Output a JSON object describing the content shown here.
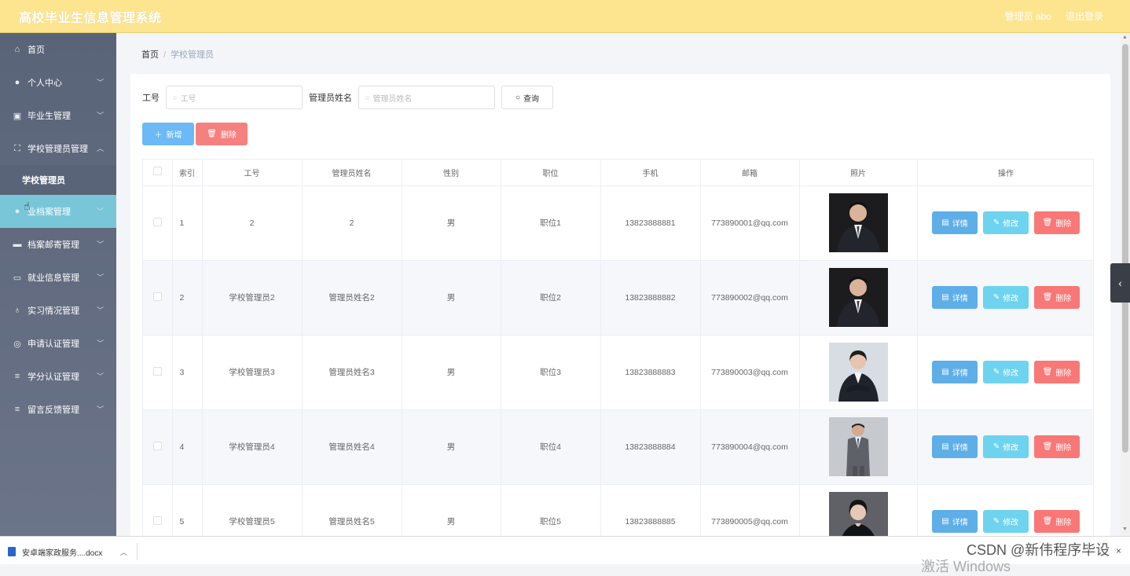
{
  "header": {
    "title": "高校毕业生信息管理系统",
    "user": "管理员 abo",
    "logout": "退出登录"
  },
  "sidebar": {
    "items": [
      {
        "label": "首页",
        "icon": "home-icon",
        "glyph": "⌂",
        "has_arrow": false
      },
      {
        "label": "个人中心",
        "icon": "user-icon",
        "glyph": "●",
        "has_arrow": true
      },
      {
        "label": "毕业生管理",
        "icon": "clipboard-icon",
        "glyph": "▣",
        "has_arrow": true
      },
      {
        "label": "学校管理员管理",
        "icon": "fullscreen-icon",
        "glyph": "⛶",
        "has_arrow": true,
        "expanded": true
      },
      {
        "label": "学校管理员",
        "submenu": true
      },
      {
        "label": "毕业档案管理",
        "icon": "user-icon",
        "glyph": "●",
        "has_arrow": true,
        "active": true,
        "visible_label": "业档案管理"
      },
      {
        "label": "档案邮寄管理",
        "icon": "briefcase-icon",
        "glyph": "▬",
        "has_arrow": true
      },
      {
        "label": "就业信息管理",
        "icon": "chat-icon",
        "glyph": "▭",
        "has_arrow": true
      },
      {
        "label": "实习情况管理",
        "icon": "microphone-icon",
        "glyph": "♁",
        "has_arrow": true
      },
      {
        "label": "申请认证管理",
        "icon": "compass-icon",
        "glyph": "◎",
        "has_arrow": true
      },
      {
        "label": "学分认证管理",
        "icon": "list-icon",
        "glyph": "≡",
        "has_arrow": true
      },
      {
        "label": "留言反馈管理",
        "icon": "list-icon",
        "glyph": "≡",
        "has_arrow": true
      }
    ]
  },
  "breadcrumb": {
    "home": "首页",
    "current": "学校管理员"
  },
  "search": {
    "id_label": "工号",
    "id_placeholder": "工号",
    "name_label": "管理员姓名",
    "name_placeholder": "管理员姓名",
    "query_button": "查询"
  },
  "actions": {
    "add": "新增",
    "delete": "删除"
  },
  "table": {
    "headers": [
      "",
      "索引",
      "工号",
      "管理员姓名",
      "性别",
      "职位",
      "手机",
      "邮箱",
      "照片",
      "操作"
    ],
    "rows": [
      {
        "index": "1",
        "id": "2",
        "name": "2",
        "gender": "男",
        "position": "职位1",
        "phone": "13823888881",
        "email": "773890001@qq.com",
        "photo": "man-suit"
      },
      {
        "index": "2",
        "id": "学校管理员2",
        "name": "管理员姓名2",
        "gender": "男",
        "position": "职位2",
        "phone": "13823888882",
        "email": "773890002@qq.com",
        "photo": "man-suit"
      },
      {
        "index": "3",
        "id": "学校管理员3",
        "name": "管理员姓名3",
        "gender": "男",
        "position": "职位3",
        "phone": "13823888883",
        "email": "773890003@qq.com",
        "photo": "woman-suit"
      },
      {
        "index": "4",
        "id": "学校管理员4",
        "name": "管理员姓名4",
        "gender": "男",
        "position": "职位4",
        "phone": "13823888884",
        "email": "773890004@qq.com",
        "photo": "man-grey"
      },
      {
        "index": "5",
        "id": "学校管理员5",
        "name": "管理员姓名5",
        "gender": "男",
        "position": "职位5",
        "phone": "13823888885",
        "email": "773890005@qq.com",
        "photo": "woman-dark"
      }
    ],
    "row_actions": {
      "detail": "详情",
      "edit": "修改",
      "delete": "删除"
    }
  },
  "download_bar": {
    "file": "安卓端家政服务....docx"
  },
  "watermark": "CSDN @新伟程序毕设",
  "os_overlay": "激活 Windows",
  "colors": {
    "header": "#fde58f",
    "sidebar": "#5a6478",
    "active_menu": "#7ac6d9",
    "add": "#6cb9f5",
    "delete": "#f58080",
    "detail": "#5eaee8",
    "edit": "#6ed3ef"
  }
}
